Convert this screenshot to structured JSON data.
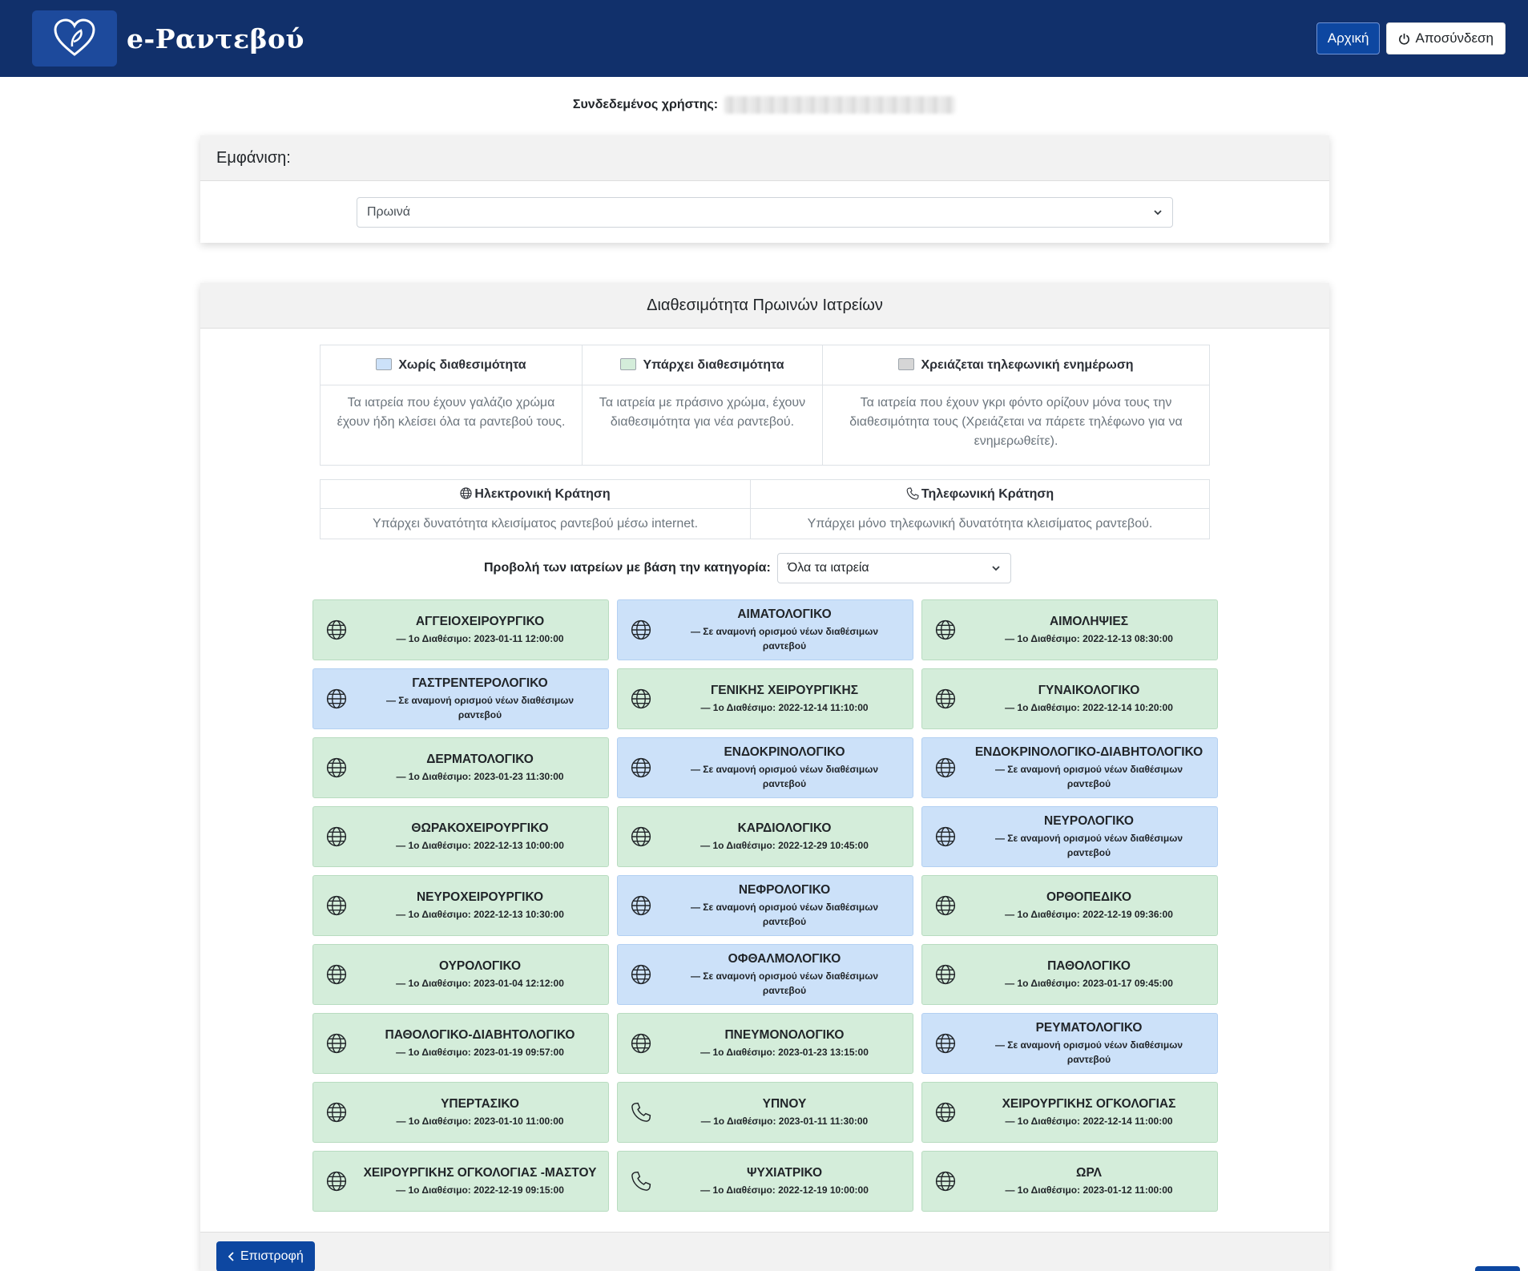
{
  "nav": {
    "brand": "e-Ραντεβού",
    "home_label": "Αρχική",
    "logout_label": "Αποσύνδεση"
  },
  "user": {
    "label": "Συνδεδεμένος χρήστης:"
  },
  "view": {
    "header": "Εμφάνιση:",
    "selected": "Πρωινά"
  },
  "availability": {
    "header": "Διαθεσιμότητα Πρωινών Ιατρείων",
    "legend": [
      {
        "title": "Χωρίς διαθεσιμότητα",
        "desc": "Τα ιατρεία που έχουν γαλάζιο χρώμα έχουν ήδη κλείσει όλα τα ραντεβού τους."
      },
      {
        "title": "Υπάρχει διαθεσιμότητα",
        "desc": "Τα ιατρεία με πράσινο χρώμα, έχουν διαθεσιμότητα για νέα ραντεβού."
      },
      {
        "title": "Χρειάζεται τηλεφωνική ενημέρωση",
        "desc": "Τα ιατρεία που έχουν γκρι φόντο ορίζουν μόνα τους την διαθεσιμότητα τους (Χρειάζεται να πάρετε τηλέφωνο για να ενημερωθείτε)."
      }
    ],
    "legend_colors": [
      "#cce1f9",
      "#d4edda",
      "#d6d6d6"
    ],
    "booking": [
      {
        "title": "Ηλεκτρονική Κράτηση",
        "desc": "Υπάρχει δυνατότητα κλεισίματος ραντεβού μέσω internet.",
        "icon": "globe-icon"
      },
      {
        "title": "Τηλεφωνική Κράτηση",
        "desc": "Υπάρχει μόνο τηλεφωνική δυνατότητα κλεισίματος ραντεβού.",
        "icon": "phone-icon"
      }
    ],
    "filter_label": "Προβολή των ιατρείων με βάση την κατηγορία:",
    "filter_selected": "Όλα τα ιατρεία",
    "clinics": [
      {
        "name": "ΑΓΓΕΙΟΧΕΙΡΟΥΡΓΙΚΟ",
        "sub": "— 1ο Διαθέσιμο: 2023-01-11 12:00:00",
        "status": "green",
        "icon": "globe"
      },
      {
        "name": "ΑΙΜΑΤΟΛΟΓΙΚΟ",
        "sub": "— Σε αναμονή ορισμού νέων διαθέσιμων ραντεβού",
        "status": "blue",
        "icon": "globe"
      },
      {
        "name": "ΑΙΜΟΛΗΨΙΕΣ",
        "sub": "— 1ο Διαθέσιμο: 2022-12-13 08:30:00",
        "status": "green",
        "icon": "globe"
      },
      {
        "name": "ΓΑΣΤΡΕΝΤΕΡΟΛΟΓΙΚΟ",
        "sub": "— Σε αναμονή ορισμού νέων διαθέσιμων ραντεβού",
        "status": "blue",
        "icon": "globe"
      },
      {
        "name": "ΓΕΝΙΚΗΣ ΧΕΙΡΟΥΡΓΙΚΗΣ",
        "sub": "— 1ο Διαθέσιμο: 2022-12-14 11:10:00",
        "status": "green",
        "icon": "globe"
      },
      {
        "name": "ΓΥΝΑΙΚΟΛΟΓΙΚΟ",
        "sub": "— 1ο Διαθέσιμο: 2022-12-14 10:20:00",
        "status": "green",
        "icon": "globe"
      },
      {
        "name": "ΔΕΡΜΑΤΟΛΟΓΙΚΟ",
        "sub": "— 1ο Διαθέσιμο: 2023-01-23 11:30:00",
        "status": "green",
        "icon": "globe"
      },
      {
        "name": "ΕΝΔΟΚΡΙΝΟΛΟΓΙΚΟ",
        "sub": "— Σε αναμονή ορισμού νέων διαθέσιμων ραντεβού",
        "status": "blue",
        "icon": "globe"
      },
      {
        "name": "ΕΝΔΟΚΡΙΝΟΛΟΓΙΚΟ-ΔΙΑΒΗΤΟΛΟΓΙΚΟ",
        "sub": "— Σε αναμονή ορισμού νέων διαθέσιμων ραντεβού",
        "status": "blue",
        "icon": "globe"
      },
      {
        "name": "ΘΩΡΑΚΟΧΕΙΡΟΥΡΓΙΚΟ",
        "sub": "— 1ο Διαθέσιμο: 2022-12-13 10:00:00",
        "status": "green",
        "icon": "globe"
      },
      {
        "name": "ΚΑΡΔΙΟΛΟΓΙΚΟ",
        "sub": "— 1ο Διαθέσιμο: 2022-12-29 10:45:00",
        "status": "green",
        "icon": "globe"
      },
      {
        "name": "ΝΕΥΡΟΛΟΓΙΚΟ",
        "sub": "— Σε αναμονή ορισμού νέων διαθέσιμων ραντεβού",
        "status": "blue",
        "icon": "globe"
      },
      {
        "name": "ΝΕΥΡΟΧΕΙΡΟΥΡΓΙΚΟ",
        "sub": "— 1ο Διαθέσιμο: 2022-12-13 10:30:00",
        "status": "green",
        "icon": "globe"
      },
      {
        "name": "ΝΕΦΡΟΛΟΓΙΚΟ",
        "sub": "— Σε αναμονή ορισμού νέων διαθέσιμων ραντεβού",
        "status": "blue",
        "icon": "globe"
      },
      {
        "name": "ΟΡΘΟΠΕΔΙΚΟ",
        "sub": "— 1ο Διαθέσιμο: 2022-12-19 09:36:00",
        "status": "green",
        "icon": "globe"
      },
      {
        "name": "ΟΥΡΟΛΟΓΙΚΟ",
        "sub": "— 1ο Διαθέσιμο: 2023-01-04 12:12:00",
        "status": "green",
        "icon": "globe"
      },
      {
        "name": "ΟΦΘΑΛΜΟΛΟΓΙΚΟ",
        "sub": "— Σε αναμονή ορισμού νέων διαθέσιμων ραντεβού",
        "status": "blue",
        "icon": "globe"
      },
      {
        "name": "ΠΑΘΟΛΟΓΙΚΟ",
        "sub": "— 1ο Διαθέσιμο: 2023-01-17 09:45:00",
        "status": "green",
        "icon": "globe"
      },
      {
        "name": "ΠΑΘΟΛΟΓΙΚΟ-ΔΙΑΒΗΤΟΛΟΓΙΚΟ",
        "sub": "— 1ο Διαθέσιμο: 2023-01-19 09:57:00",
        "status": "green",
        "icon": "globe"
      },
      {
        "name": "ΠΝΕΥΜΟΝΟΛΟΓΙΚΟ",
        "sub": "— 1ο Διαθέσιμο: 2023-01-23 13:15:00",
        "status": "green",
        "icon": "globe"
      },
      {
        "name": "ΡΕΥΜΑΤΟΛΟΓΙΚΟ",
        "sub": "— Σε αναμονή ορισμού νέων διαθέσιμων ραντεβού",
        "status": "blue",
        "icon": "globe"
      },
      {
        "name": "ΥΠΕΡΤΑΣΙΚΟ",
        "sub": "— 1ο Διαθέσιμο: 2023-01-10 11:00:00",
        "status": "green",
        "icon": "globe"
      },
      {
        "name": "ΥΠΝΟΥ",
        "sub": "— 1ο Διαθέσιμο: 2023-01-11 11:30:00",
        "status": "green",
        "icon": "phone"
      },
      {
        "name": "ΧΕΙΡΟΥΡΓΙΚΗΣ ΟΓΚΟΛΟΓΙΑΣ",
        "sub": "— 1ο Διαθέσιμο: 2022-12-14 11:00:00",
        "status": "green",
        "icon": "globe"
      },
      {
        "name": "ΧΕΙΡΟΥΡΓΙΚΗΣ ΟΓΚΟΛΟΓΙΑΣ -ΜΑΣΤΟΥ",
        "sub": "— 1ο Διαθέσιμο: 2022-12-19 09:15:00",
        "status": "green",
        "icon": "globe"
      },
      {
        "name": "ΨΥΧΙΑΤΡΙΚΟ",
        "sub": "— 1ο Διαθέσιμο: 2022-12-19 10:00:00",
        "status": "green",
        "icon": "phone"
      },
      {
        "name": "ΩΡΛ",
        "sub": "— 1ο Διαθέσιμο: 2023-01-12 11:00:00",
        "status": "green",
        "icon": "globe"
      }
    ],
    "back_label": "Επιστροφή"
  }
}
